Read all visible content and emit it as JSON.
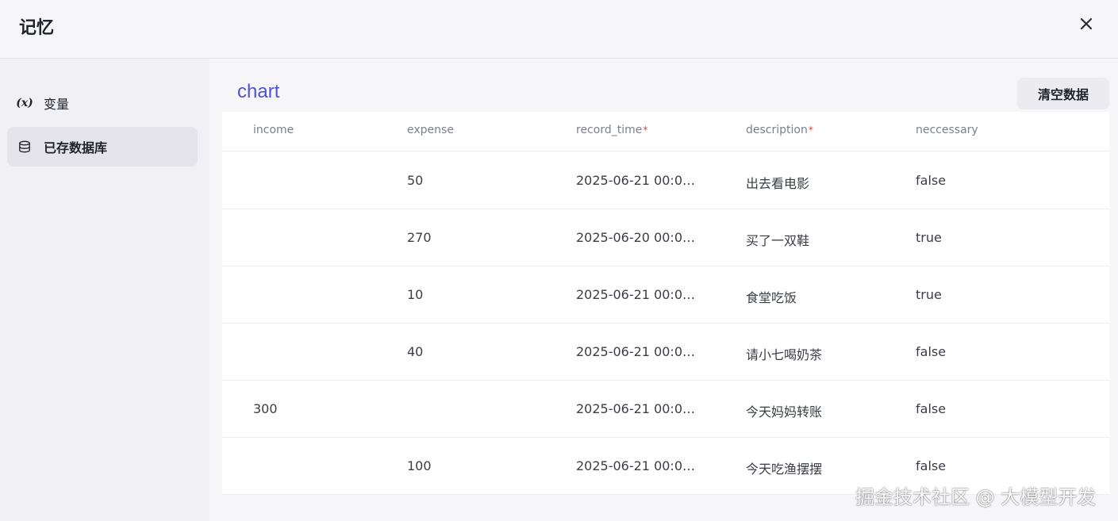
{
  "header": {
    "title": "记忆",
    "close_icon": "close-icon"
  },
  "sidebar": {
    "items": [
      {
        "icon_text": "(x)",
        "icon": "variable-icon",
        "label": "变量"
      },
      {
        "icon": "database-icon",
        "label": "已存数据库"
      }
    ]
  },
  "panel": {
    "title": "chart",
    "clear_button": "清空数据"
  },
  "table": {
    "columns": [
      {
        "label": "income",
        "required": false
      },
      {
        "label": "expense",
        "required": false
      },
      {
        "label": "record_time",
        "required": true,
        "required_mark": "*"
      },
      {
        "label": "description",
        "required": true,
        "required_mark": "*"
      },
      {
        "label": "neccessary",
        "required": false
      }
    ],
    "rows": [
      [
        "",
        "50",
        "2025-06-21 00:0…",
        "出去看电影",
        "false"
      ],
      [
        "",
        "270",
        "2025-06-20 00:0…",
        "买了一双鞋",
        "true"
      ],
      [
        "",
        "10",
        "2025-06-21 00:0…",
        "食堂吃饭",
        "true"
      ],
      [
        "",
        "40",
        "2025-06-21 00:0…",
        "请小七喝奶茶",
        "false"
      ],
      [
        "300",
        "",
        "2025-06-21 00:0…",
        "今天妈妈转账",
        "false"
      ],
      [
        "",
        "100",
        "2025-06-21 00:0…",
        "今天吃渔摆摆",
        "false"
      ]
    ]
  },
  "watermark": "掘金技术社区 @ 大模型开发",
  "colors": {
    "accent": "#4f52d6",
    "required": "#e53935",
    "active_bg": "#e4e4ea"
  }
}
